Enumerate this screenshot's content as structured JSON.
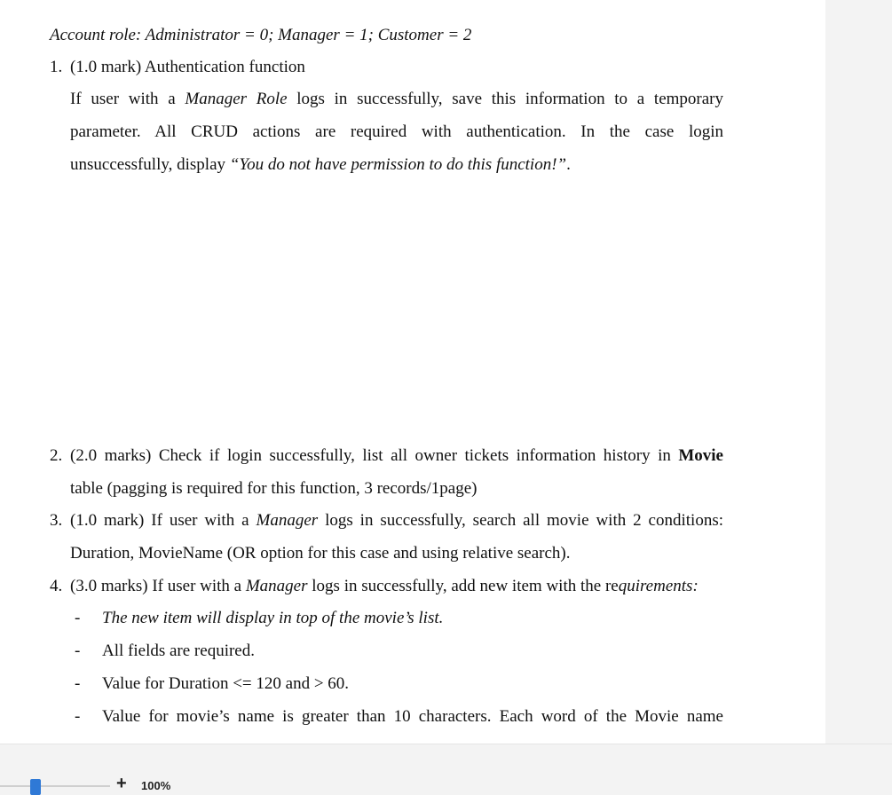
{
  "document": {
    "roles_line": "Account role: Administrator = 0; Manager = 1; Customer = 2",
    "q1": {
      "number": "1.",
      "heading": "(1.0 mark) Authentication function",
      "p1_a": "If user with a ",
      "p1_manager_role": "Manager Role",
      "p1_b": " logs in successfully, save this information to a temporary",
      "p2": "parameter. All CRUD actions are required with authentication. In the case login",
      "p3_a": "unsuccessfully, display ",
      "p3_quote": "“You do not have permission to do this function!”",
      "p3_b": "."
    },
    "q2": {
      "number": "2.",
      "line1_a": "(2.0 marks) Check if login successfully, list all owner tickets information history in ",
      "line1_bold": "Movie",
      "line2": "table (pagging is required for this function, 3 records/1page)"
    },
    "q3": {
      "number": "3.",
      "line1_a": "(1.0 mark) If user with a ",
      "line1_manager": "Manager",
      "line1_b": " logs in successfully, search all movie with 2 conditions:",
      "line2": "Duration, MovieName (OR option for this case and using relative search)."
    },
    "q4": {
      "number": "4.",
      "line1_a": "(3.0 marks) If user with a ",
      "line1_manager": "Manager",
      "line1_b": " logs in successfully, add new item with the re",
      "line1_req": "quirements:",
      "bullets": [
        "The new item will display in top of the movie’s list.",
        "All fields are required.",
        "Value for Duration <= 120 and > 60.",
        "Value for movie’s name is greater than 10 characters. Each word of the Movie name"
      ],
      "dash": "-"
    }
  },
  "statusbar": {
    "zoom_plus": "+",
    "zoom_level": "100%",
    "zoom_fraction": 0.3
  }
}
